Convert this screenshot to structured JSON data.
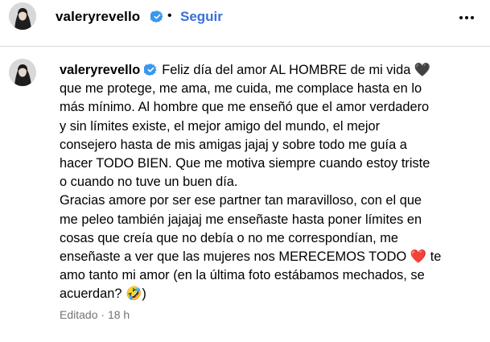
{
  "header": {
    "username": "valeryrevello",
    "verified_icon": "verified-badge-icon",
    "separator": "•",
    "follow_label": "Seguir",
    "more_icon": "more-options-icon"
  },
  "caption": {
    "username": "valeryrevello",
    "verified_icon": "verified-badge-icon",
    "text": "Feliz día del amor AL HOMBRE de mi vida 🖤\nque me protege, me ama, me cuida, me complace hasta en lo\nmás mínimo. Al hombre que me enseñó que el amor verdadero\ny sin límites existe, el mejor amigo del mundo, el mejor\nconsejero hasta de mis amigas jajaj y sobre todo me guía a\nhacer TODO BIEN. Que me motiva siempre cuando estoy triste\no cuando no tuve un buen día.\nGracias amore por ser ese partner tan maravilloso, con el que\nme peleo también jajajaj me enseñaste hasta poner límites en\ncosas que creía que no debía o no me correspondían, me\nenseñaste a ver que las mujeres nos MERECEMOS TODO ❤️ te\namo tanto mi amor (en la última foto estábamos mechados, se\nacuerdan? 🤣)"
  },
  "meta": {
    "edited_label": "Editado",
    "separator": "·",
    "time": "18 h"
  },
  "colors": {
    "follow": "#3a6fd8",
    "verified": "#3897f0",
    "meta": "#737373",
    "divider": "#dbdbdb"
  }
}
